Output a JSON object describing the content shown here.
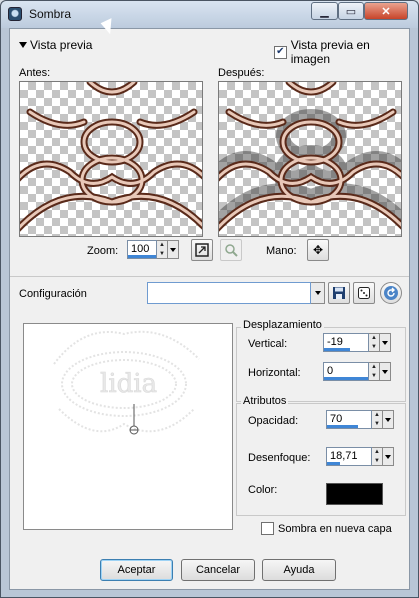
{
  "window": {
    "title": "Sombra"
  },
  "preview": {
    "toggle_label": "Vista previa",
    "in_image_label": "Vista previa en imagen",
    "in_image_checked": true,
    "before_label": "Antes:",
    "after_label": "Después:"
  },
  "zoom": {
    "label": "Zoom:",
    "value": "100",
    "pan_label": "Mano:"
  },
  "config": {
    "label": "Configuración",
    "value": ""
  },
  "displacement": {
    "title": "Desplazamiento",
    "vertical_label": "Vertical:",
    "vertical_value": "-19",
    "horizontal_label": "Horizontal:",
    "horizontal_value": "0"
  },
  "attributes": {
    "title": "Atributos",
    "opacity_label": "Opacidad:",
    "opacity_value": "70",
    "blur_label": "Desenfoque:",
    "blur_value": "18,71",
    "color_label": "Color:",
    "color_hex": "#000000"
  },
  "shadow_new_layer": {
    "label": "Sombra en nueva capa",
    "checked": false
  },
  "buttons": {
    "ok": "Aceptar",
    "cancel": "Cancelar",
    "help": "Ayuda"
  },
  "icons": {
    "app": "shadow-icon",
    "min": "minimize-icon",
    "max": "maximize-icon",
    "close": "close-icon",
    "fit": "fit-window-icon",
    "zoom_pick": "zoom-picker-icon",
    "pan": "pan-icon",
    "save": "save-preset-icon",
    "random": "randomize-dice-icon",
    "reset": "reset-icon"
  }
}
